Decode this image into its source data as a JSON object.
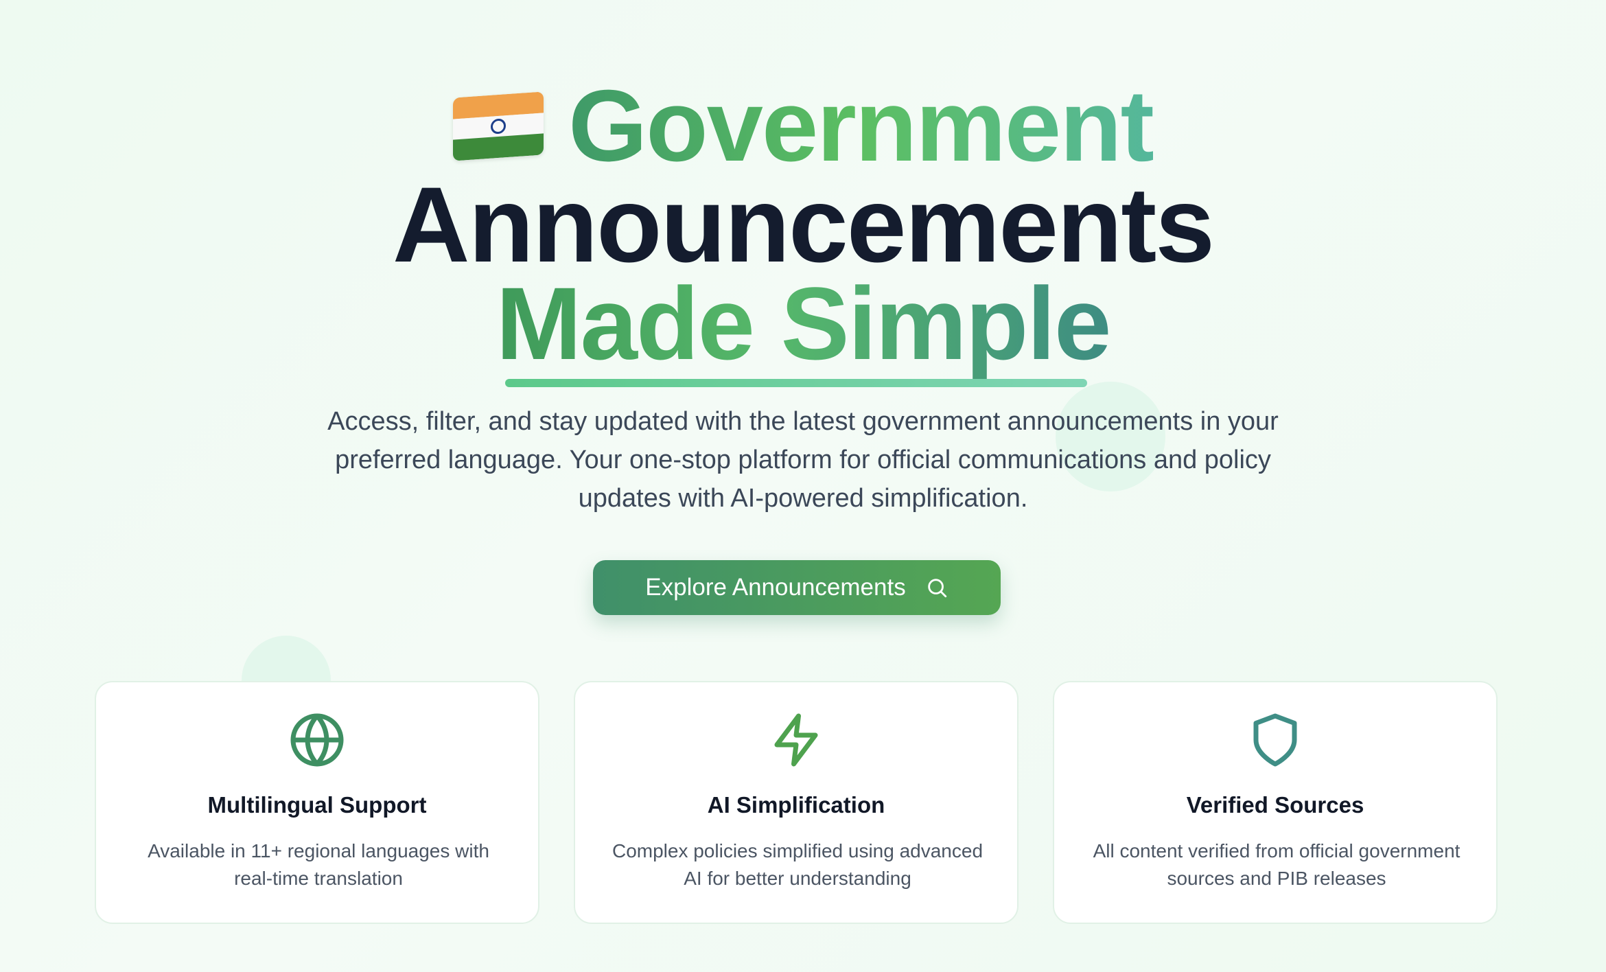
{
  "hero": {
    "title_line1": "Government",
    "title_line2": "Announcements",
    "title_line3": "Made Simple",
    "subtitle": "Access, filter, and stay updated with the latest government announcements in your preferred language. Your one-stop platform for official communications and policy updates with AI-powered simplification.",
    "flag_icon": "india-flag-emoji"
  },
  "cta": {
    "label": "Explore Announcements",
    "icon": "search-icon"
  },
  "features": [
    {
      "title": "Multilingual Support",
      "description": "Available in 11+ regional languages with real-time translation",
      "icon": "globe-icon"
    },
    {
      "title": "AI Simplification",
      "description": "Complex policies simplified using advanced AI for better understanding",
      "icon": "lightning-icon"
    },
    {
      "title": "Verified Sources",
      "description": "All content verified from official government sources and PIB releases",
      "icon": "shield-icon"
    }
  ],
  "colors": {
    "accent_green": "#40906a",
    "accent_light_green": "#5cbf62",
    "teal": "#3e8d82",
    "heading_dark": "#141c2e",
    "background": "#eefaf1"
  }
}
